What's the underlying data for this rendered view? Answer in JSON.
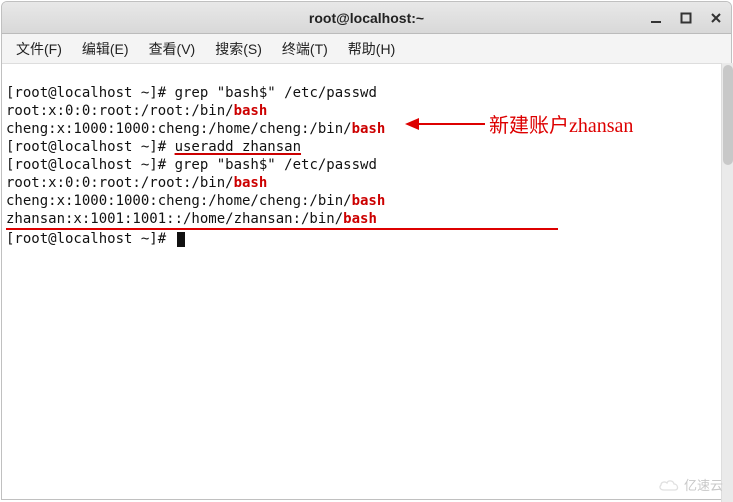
{
  "window": {
    "title": "root@localhost:~"
  },
  "menubar": {
    "items": [
      {
        "label": "文件(F)"
      },
      {
        "label": "编辑(E)"
      },
      {
        "label": "查看(V)"
      },
      {
        "label": "搜索(S)"
      },
      {
        "label": "终端(T)"
      },
      {
        "label": "帮助(H)"
      }
    ]
  },
  "terminal": {
    "prompt1_user": "[root@localhost ~]# ",
    "cmd_grep": "grep \"bash$\" /etc/passwd",
    "out_root_pre": "root:x:0:0:root:/root:/bin/",
    "out_cheng_pre": "cheng:x:1000:1000:cheng:/home/cheng:/bin/",
    "bash": "bash",
    "prompt2_user": "[root@localhost ~]# ",
    "cmd_useradd": "useradd zhansan",
    "prompt3_user": "[root@localhost ~]# ",
    "out_zhansan_pre": "zhansan:x:1001:1001::/home/zhansan:/bin/",
    "prompt4_user": "[root@localhost ~]# "
  },
  "annotation": {
    "text": "新建账户zhansan"
  },
  "watermark": {
    "text": "亿速云"
  }
}
